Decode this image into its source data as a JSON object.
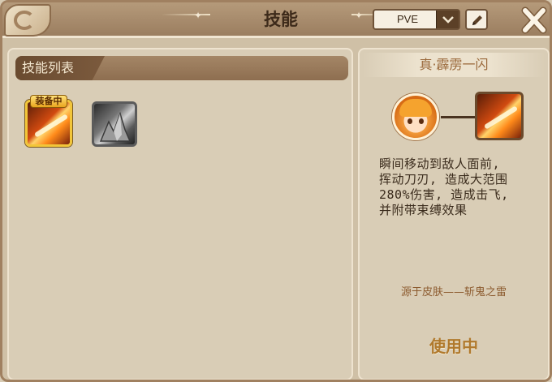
{
  "header": {
    "title": "技能",
    "mode_select": {
      "value": "PVE"
    },
    "icons": {
      "edit": "pencil-icon",
      "close": "close-icon",
      "dropdown": "chevron-down-icon"
    }
  },
  "skill_list": {
    "tab_label": "技能列表",
    "slots": [
      {
        "badge": "装备中",
        "icon": "flaming-blade-icon",
        "equipped": true
      },
      {
        "icon": "stone-spikes-icon",
        "equipped": false
      }
    ]
  },
  "detail": {
    "skill_name": "真·霹雳一闪",
    "description_lines": [
      "瞬间移动到敌人面前,",
      "挥动刀刃, 造成大范围",
      "280%伤害, 造成击飞,",
      "并附带束缚效果"
    ],
    "source": "源于皮肤——斩鬼之雷",
    "status": "使用中"
  },
  "colors": {
    "accent_gold": "#f2c63a",
    "title_text": "#3d2a1a",
    "panel_bg": "#d9cdb6"
  }
}
